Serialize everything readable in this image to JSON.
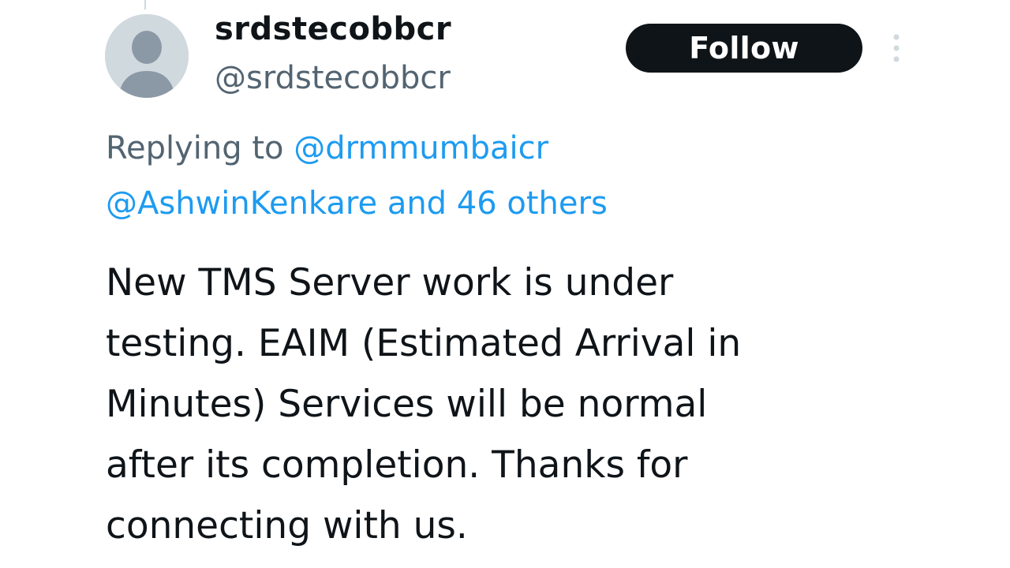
{
  "author": {
    "display_name": "srdstecobbcr",
    "handle": "@srdstecobbcr",
    "avatar_icon": "default-avatar-icon"
  },
  "follow_button": {
    "label": "Follow"
  },
  "more_menu": {
    "icon": "more-vertical-icon"
  },
  "reply_context": {
    "prefix": "Replying to",
    "mention_1": "@drmmumbaicr",
    "mention_2": "@AshwinKenkare",
    "others": "and 46 others"
  },
  "tweet": {
    "lines": [
      "New TMS Server work is under",
      "testing. EAIM (Estimated Arrival in",
      "Minutes) Services will be normal",
      "after its completion. Thanks for",
      "connecting with us."
    ]
  },
  "colors": {
    "text_primary": "#0f1419",
    "text_secondary": "#536471",
    "link": "#1d9bf0",
    "button_bg": "#0f1419",
    "avatar_bg": "#cfd9de"
  }
}
